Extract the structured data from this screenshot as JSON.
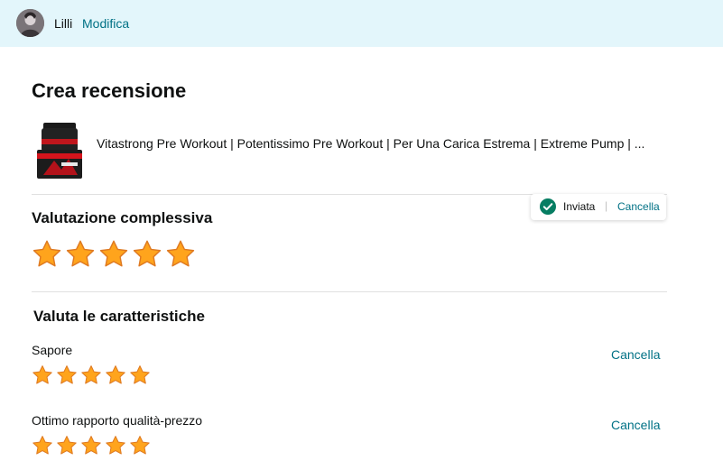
{
  "header": {
    "username": "Lilli",
    "edit_label": "Modifica"
  },
  "page": {
    "title": "Crea recensione"
  },
  "product": {
    "title": "Vitastrong Pre Workout | Potentissimo Pre Workout | Per Una Carica Estrema | Extreme Pump | ..."
  },
  "overall": {
    "title": "Valutazione complessiva",
    "rating": 5,
    "max_rating": 5,
    "status_text": "Inviata",
    "status_separator": "|",
    "cancel_label": "Cancella"
  },
  "features": {
    "title": "Valuta le caratteristiche",
    "items": [
      {
        "label": "Sapore",
        "rating": 5,
        "max_rating": 5,
        "cancel_label": "Cancella"
      },
      {
        "label": "Ottimo rapporto qualità-prezzo",
        "rating": 5,
        "max_rating": 5,
        "cancel_label": "Cancella"
      }
    ]
  },
  "colors": {
    "header_bg": "#e3f6fb",
    "link": "#007185",
    "star_fill": "#ffa41c",
    "star_stroke": "#de7921",
    "check_green": "#067d62"
  },
  "icons": {
    "avatar": "profile-avatar",
    "status": "check-circle-icon",
    "star": "star-icon"
  }
}
